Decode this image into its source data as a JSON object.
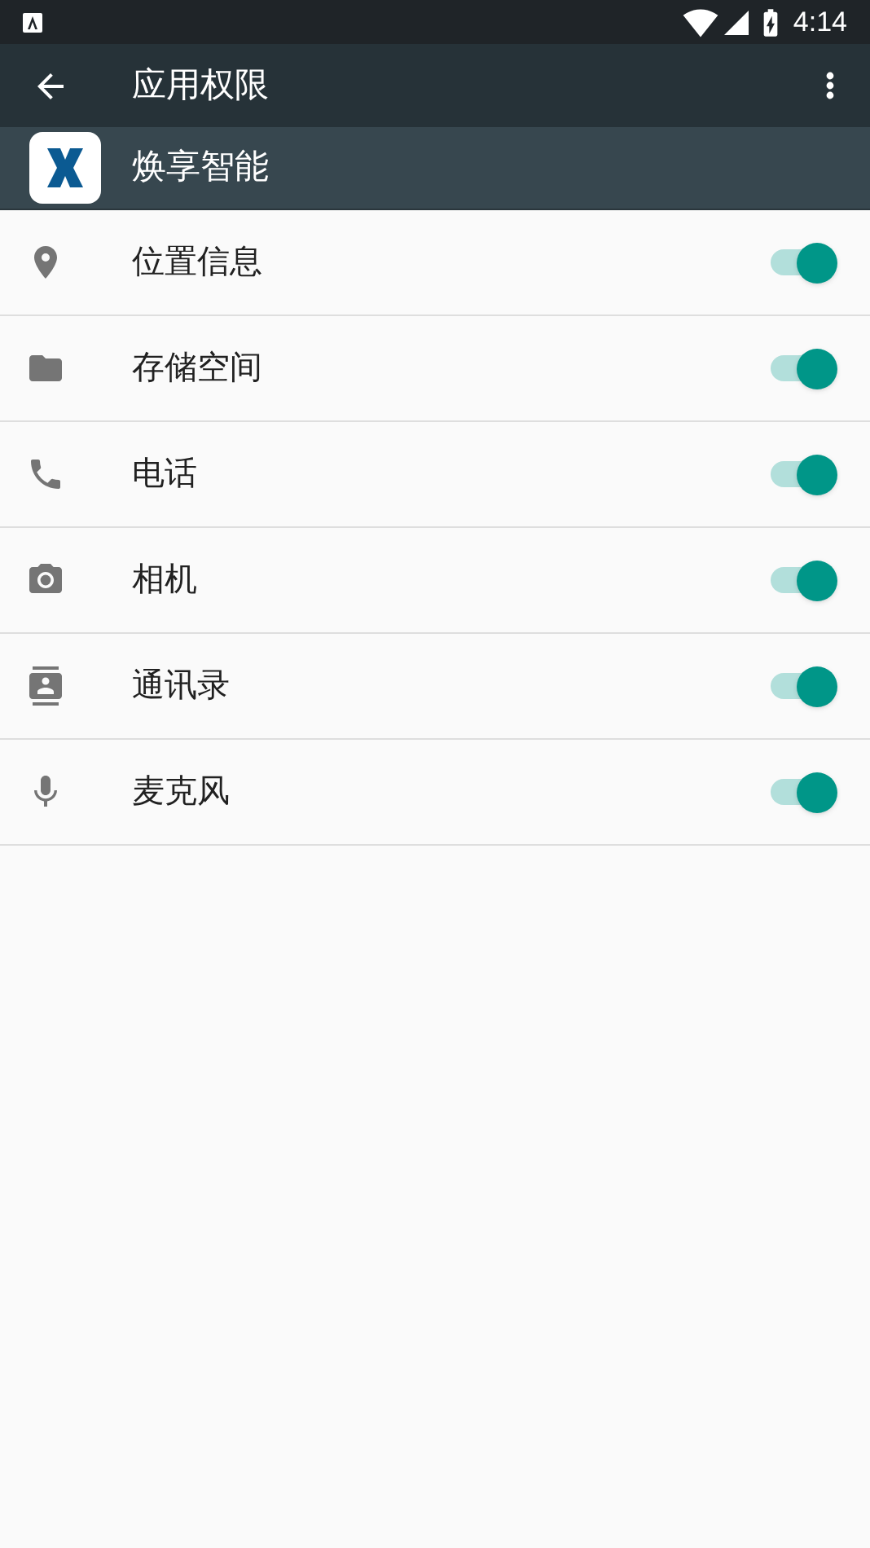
{
  "status_bar": {
    "time": "4:14"
  },
  "toolbar": {
    "title": "应用权限"
  },
  "app": {
    "name": "焕享智能"
  },
  "permissions": [
    {
      "kind": "location",
      "label": "位置信息",
      "on": true
    },
    {
      "kind": "storage",
      "label": "存储空间",
      "on": true
    },
    {
      "kind": "phone",
      "label": "电话",
      "on": true
    },
    {
      "kind": "camera",
      "label": "相机",
      "on": true
    },
    {
      "kind": "contacts",
      "label": "通讯录",
      "on": true
    },
    {
      "kind": "microphone",
      "label": "麦克风",
      "on": true
    }
  ]
}
